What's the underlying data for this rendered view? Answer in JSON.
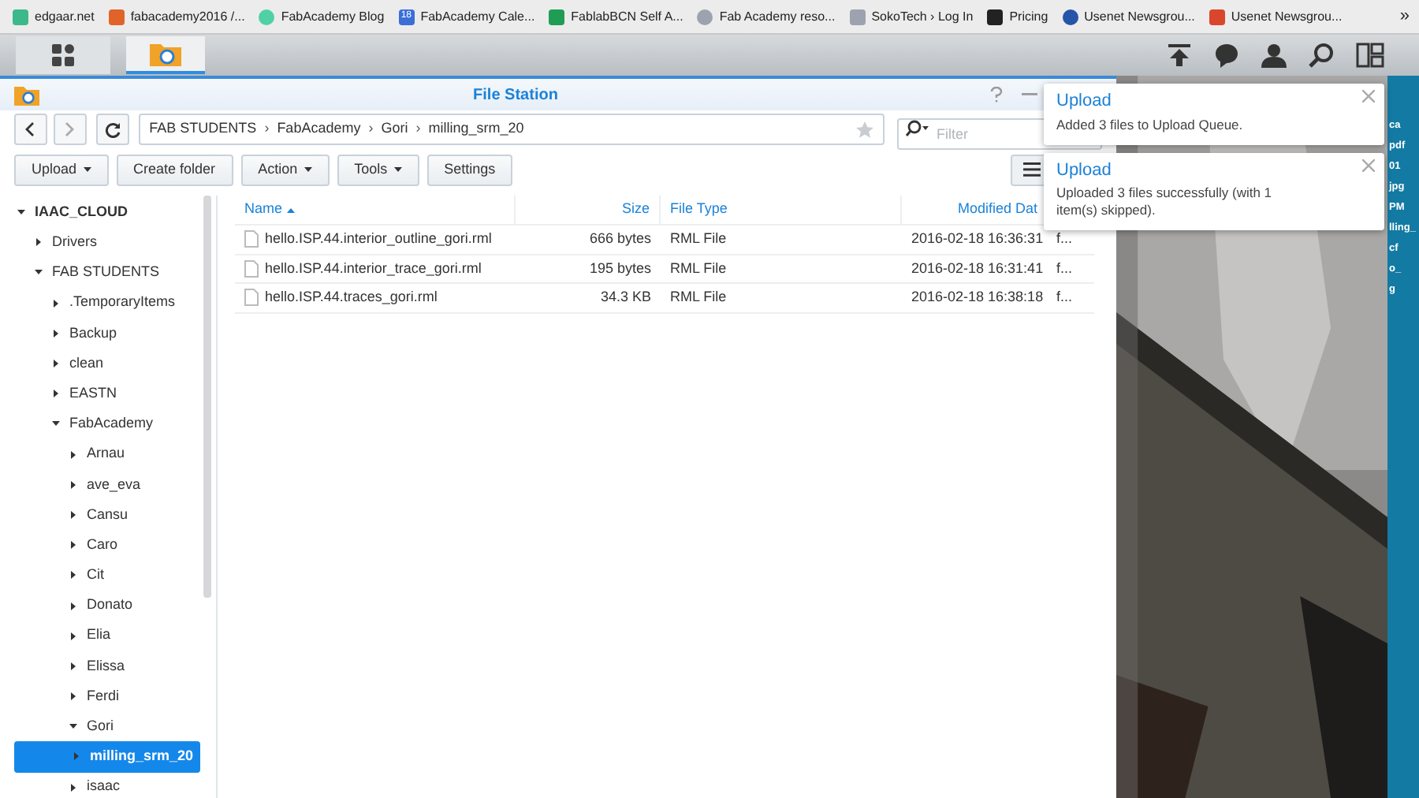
{
  "bookmarks": [
    {
      "label": "edgaar.net",
      "color": "#3cb98a"
    },
    {
      "label": "fabacademy2016 /...",
      "color": "#e2632a"
    },
    {
      "label": "FabAcademy Blog",
      "color": "#4fd1a5"
    },
    {
      "label": "FabAcademy Cale...",
      "color": "#3a6fd8"
    },
    {
      "label": "FablabBCN Self A...",
      "color": "#1f9d55"
    },
    {
      "label": "Fab Academy reso...",
      "color": "#9ca3af"
    },
    {
      "label": "SokoTech › Log In",
      "color": "#9ca3af"
    },
    {
      "label": "Pricing",
      "color": "#222222"
    },
    {
      "label": "Usenet Newsgrou...",
      "color": "#2554a8"
    },
    {
      "label": "Usenet Newsgrou...",
      "color": "#d9462b"
    }
  ],
  "bookmarks_more": "»",
  "calendar_badge": "18",
  "window": {
    "title": "File Station"
  },
  "path": [
    {
      "label": "FAB STUDENTS"
    },
    {
      "separator": "›",
      "label": "FabAcademy"
    },
    {
      "separator": "›",
      "label": "Gori"
    },
    {
      "separator": "›",
      "label": "milling_srm_20"
    }
  ],
  "filter": {
    "placeholder": "Filter"
  },
  "toolbar": [
    {
      "label": "Upload",
      "dropdown": true
    },
    {
      "label": "Create folder",
      "dropdown": false
    },
    {
      "label": "Action",
      "dropdown": true
    },
    {
      "label": "Tools",
      "dropdown": true
    },
    {
      "label": "Settings",
      "dropdown": false
    }
  ],
  "tree": [
    {
      "label": "IAAC_CLOUD",
      "expanded": true,
      "selected": false,
      "children": [
        {
          "label": "Drivers",
          "expanded": false,
          "selected": false
        },
        {
          "label": "FAB STUDENTS",
          "expanded": true,
          "selected": false,
          "children": [
            {
              "label": ".TemporaryItems",
              "expanded": false,
              "selected": false
            },
            {
              "label": "Backup",
              "expanded": false,
              "selected": false
            },
            {
              "label": "clean",
              "expanded": false,
              "selected": false
            },
            {
              "label": "EASTN",
              "expanded": false,
              "selected": false
            },
            {
              "label": "FabAcademy",
              "expanded": true,
              "selected": false,
              "children": [
                {
                  "label": "Arnau",
                  "expanded": false,
                  "selected": false
                },
                {
                  "label": "ave_eva",
                  "expanded": false,
                  "selected": false
                },
                {
                  "label": "Cansu",
                  "expanded": false,
                  "selected": false
                },
                {
                  "label": "Caro",
                  "expanded": false,
                  "selected": false
                },
                {
                  "label": "Cit",
                  "expanded": false,
                  "selected": false
                },
                {
                  "label": "Donato",
                  "expanded": false,
                  "selected": false
                },
                {
                  "label": "Elia",
                  "expanded": false,
                  "selected": false
                },
                {
                  "label": "Elissa",
                  "expanded": false,
                  "selected": false
                },
                {
                  "label": "Ferdi",
                  "expanded": false,
                  "selected": false
                },
                {
                  "label": "Gori",
                  "expanded": true,
                  "selected": false,
                  "children": [
                    {
                      "label": "milling_srm_20",
                      "expanded": false,
                      "selected": true
                    }
                  ]
                },
                {
                  "label": "isaac",
                  "expanded": false,
                  "selected": false
                }
              ]
            }
          ]
        }
      ]
    }
  ],
  "table": {
    "columns": [
      {
        "label": "Name",
        "sorted": true
      },
      {
        "label": "Size",
        "sorted": false
      },
      {
        "label": "File Type",
        "sorted": false
      },
      {
        "label": "Modified Dat",
        "sorted": false
      }
    ],
    "rows": [
      {
        "name": "hello.ISP.44.interior_outline_gori.rml",
        "size": "666 bytes",
        "type": "RML File",
        "modified": "2016-02-18 16:36:31",
        "column_5": "f..."
      },
      {
        "name": "hello.ISP.44.interior_trace_gori.rml",
        "size": "195 bytes",
        "type": "RML File",
        "modified": "2016-02-18 16:31:41",
        "column_5": "f..."
      },
      {
        "name": "hello.ISP.44.traces_gori.rml",
        "size": "34.3 KB",
        "type": "RML File",
        "modified": "2016-02-18 16:38:18",
        "column_5": "f..."
      }
    ]
  },
  "notifications": [
    {
      "title": "Upload",
      "message": "Added 3 files to Upload Queue."
    },
    {
      "title": "Upload",
      "message": "Uploaded 3 files successfully (with 1 item(s) skipped)."
    }
  ],
  "desktop_labels": [
    "ca",
    "pdf",
    "01",
    "jpg",
    "PM",
    "lling_",
    "cf",
    "o_",
    "g"
  ]
}
